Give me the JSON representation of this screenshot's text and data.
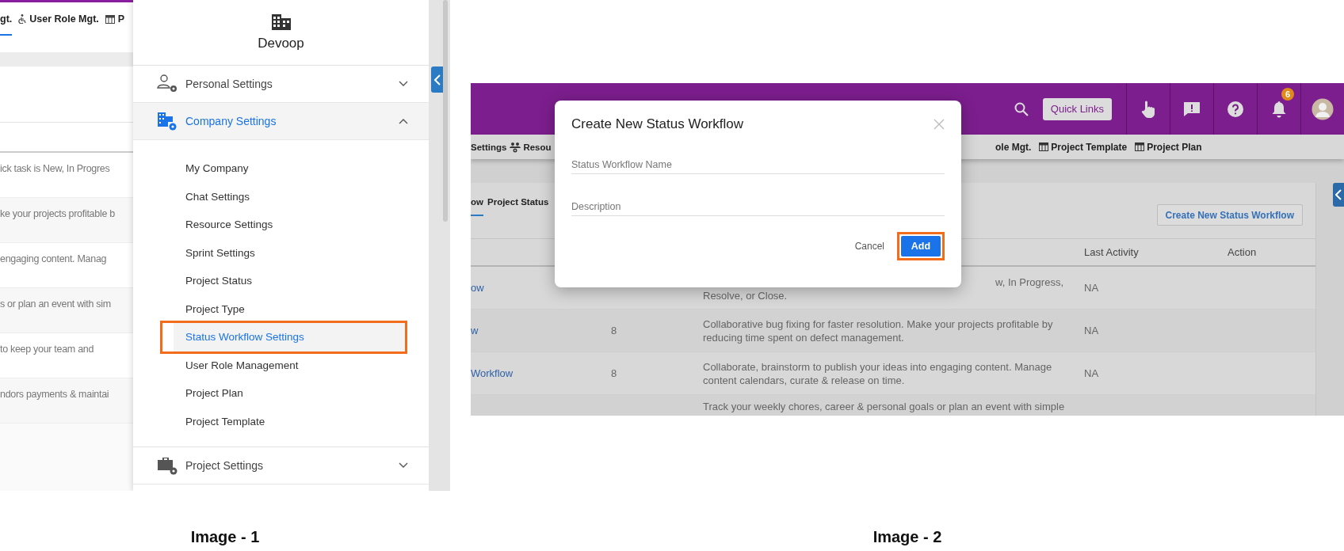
{
  "image_1": {
    "tabs": [
      {
        "label": "gt.",
        "selected": true
      },
      {
        "label": "User Role Mgt.",
        "selected": false
      },
      {
        "label": "P",
        "selected": false
      }
    ],
    "rows": [
      "ick task is New, In Progres",
      "ke your projects profitable b",
      "engaging content. Manag",
      "s or plan an event with sim",
      "to keep your team and",
      "ndors payments & maintai"
    ],
    "drawer": {
      "title": "Devoop",
      "sections": [
        {
          "label": "Personal Settings",
          "expanded": false
        },
        {
          "label": "Company Settings",
          "expanded": true,
          "items": [
            {
              "label": "My Company",
              "selected": false,
              "highlighted": false
            },
            {
              "label": "Chat Settings",
              "selected": false,
              "highlighted": false
            },
            {
              "label": "Resource Settings",
              "selected": false,
              "highlighted": false
            },
            {
              "label": "Sprint Settings",
              "selected": false,
              "highlighted": false
            },
            {
              "label": "Project Status",
              "selected": false,
              "highlighted": false
            },
            {
              "label": "Project Type",
              "selected": false,
              "highlighted": false
            },
            {
              "label": "Status Workflow Settings",
              "selected": true,
              "highlighted": true
            },
            {
              "label": "User Role Management",
              "selected": false,
              "highlighted": false
            },
            {
              "label": "Project Plan",
              "selected": false,
              "highlighted": false
            },
            {
              "label": "Project Template",
              "selected": false,
              "highlighted": false
            }
          ]
        },
        {
          "label": "Project Settings",
          "expanded": false
        }
      ]
    },
    "caption": "Image - 1"
  },
  "image_2": {
    "header": {
      "quick_links": "Quick Links",
      "notification_count": "6"
    },
    "tabs": [
      {
        "label": "Settings"
      },
      {
        "label": "Resou"
      },
      {
        "label": "ole Mgt."
      },
      {
        "label": "Project Template"
      },
      {
        "label": "Project Plan"
      }
    ],
    "card": {
      "tabs": [
        {
          "label": "ow",
          "selected": true
        },
        {
          "label": "Project Status",
          "selected": false
        }
      ],
      "create_button": "Create New Status Workflow",
      "columns": [
        "Last Activity",
        "Action"
      ],
      "rows": [
        {
          "name": "ow",
          "description": [
            "w, In Progress,",
            "Resolve, or Close."
          ],
          "last_activity": "NA"
        },
        {
          "name": "w",
          "count": "8",
          "description": [
            "Collaborative bug fixing for faster resolution. Make your projects profitable by",
            "reducing time spent on defect management."
          ],
          "last_activity": "NA"
        },
        {
          "name": "Workflow",
          "count": "8",
          "description": [
            "Collaborate, brainstorm to publish your ideas into engaging content. Manage",
            "content calendars, curate & release on time."
          ],
          "last_activity": "NA"
        },
        {
          "description": [
            "Track your weekly chores, career & personal goals or plan an event with simple"
          ]
        }
      ]
    },
    "dialog": {
      "title": "Create New Status Workflow",
      "fields": [
        {
          "placeholder": "Status Workflow Name"
        },
        {
          "placeholder": "Description"
        }
      ],
      "cancel": "Cancel",
      "add": "Add",
      "add_highlighted": true
    },
    "caption": "Image - 2"
  }
}
